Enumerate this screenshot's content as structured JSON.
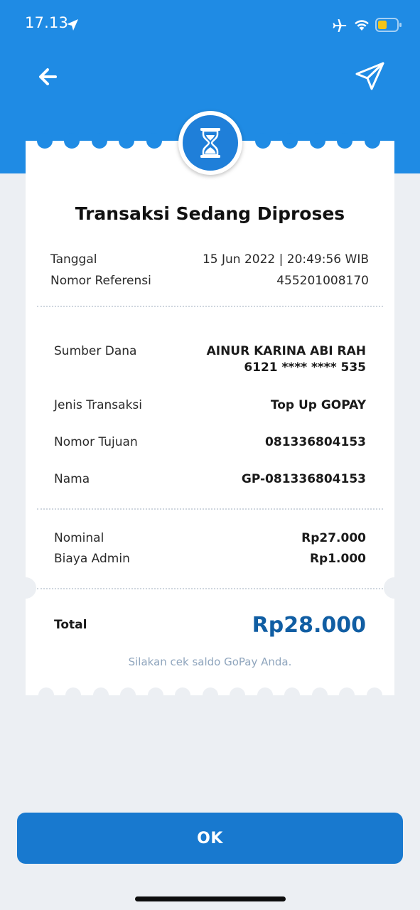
{
  "status_bar": {
    "time": "17.13",
    "icons": [
      "location-arrow-icon",
      "airplane-mode-icon",
      "wifi-icon",
      "battery-icon"
    ],
    "battery_color": "#f2c418"
  },
  "nav": {
    "back_icon": "arrow-left-icon",
    "share_icon": "paper-plane-icon"
  },
  "colors": {
    "header_blue": "#1f8be4",
    "total_blue": "#115ea3",
    "button_blue": "#1879cf",
    "background": "#eceff3"
  },
  "status_icon": "hourglass-icon",
  "receipt": {
    "title": "Transaksi Sedang Diproses",
    "meta": {
      "date_label": "Tanggal",
      "date_value": "15 Jun 2022 | 20:49:56 WIB",
      "ref_label": "Nomor Referensi",
      "ref_value": "455201008170"
    },
    "details": {
      "source_label": "Sumber Dana",
      "source_name": "AINUR KARINA ABI RAH",
      "source_account": "6121 **** **** 535",
      "type_label": "Jenis Transaksi",
      "type_value": "Top Up GOPAY",
      "dest_label": "Nomor Tujuan",
      "dest_value": "081336804153",
      "name_label": "Nama",
      "name_value": "GP-081336804153"
    },
    "amounts": {
      "nominal_label": "Nominal",
      "nominal_value": "Rp27.000",
      "fee_label": "Biaya Admin",
      "fee_value": "Rp1.000"
    },
    "total": {
      "label": "Total",
      "value": "Rp28.000"
    },
    "note": "Silakan cek saldo GoPay Anda."
  },
  "ok_button": "OK"
}
